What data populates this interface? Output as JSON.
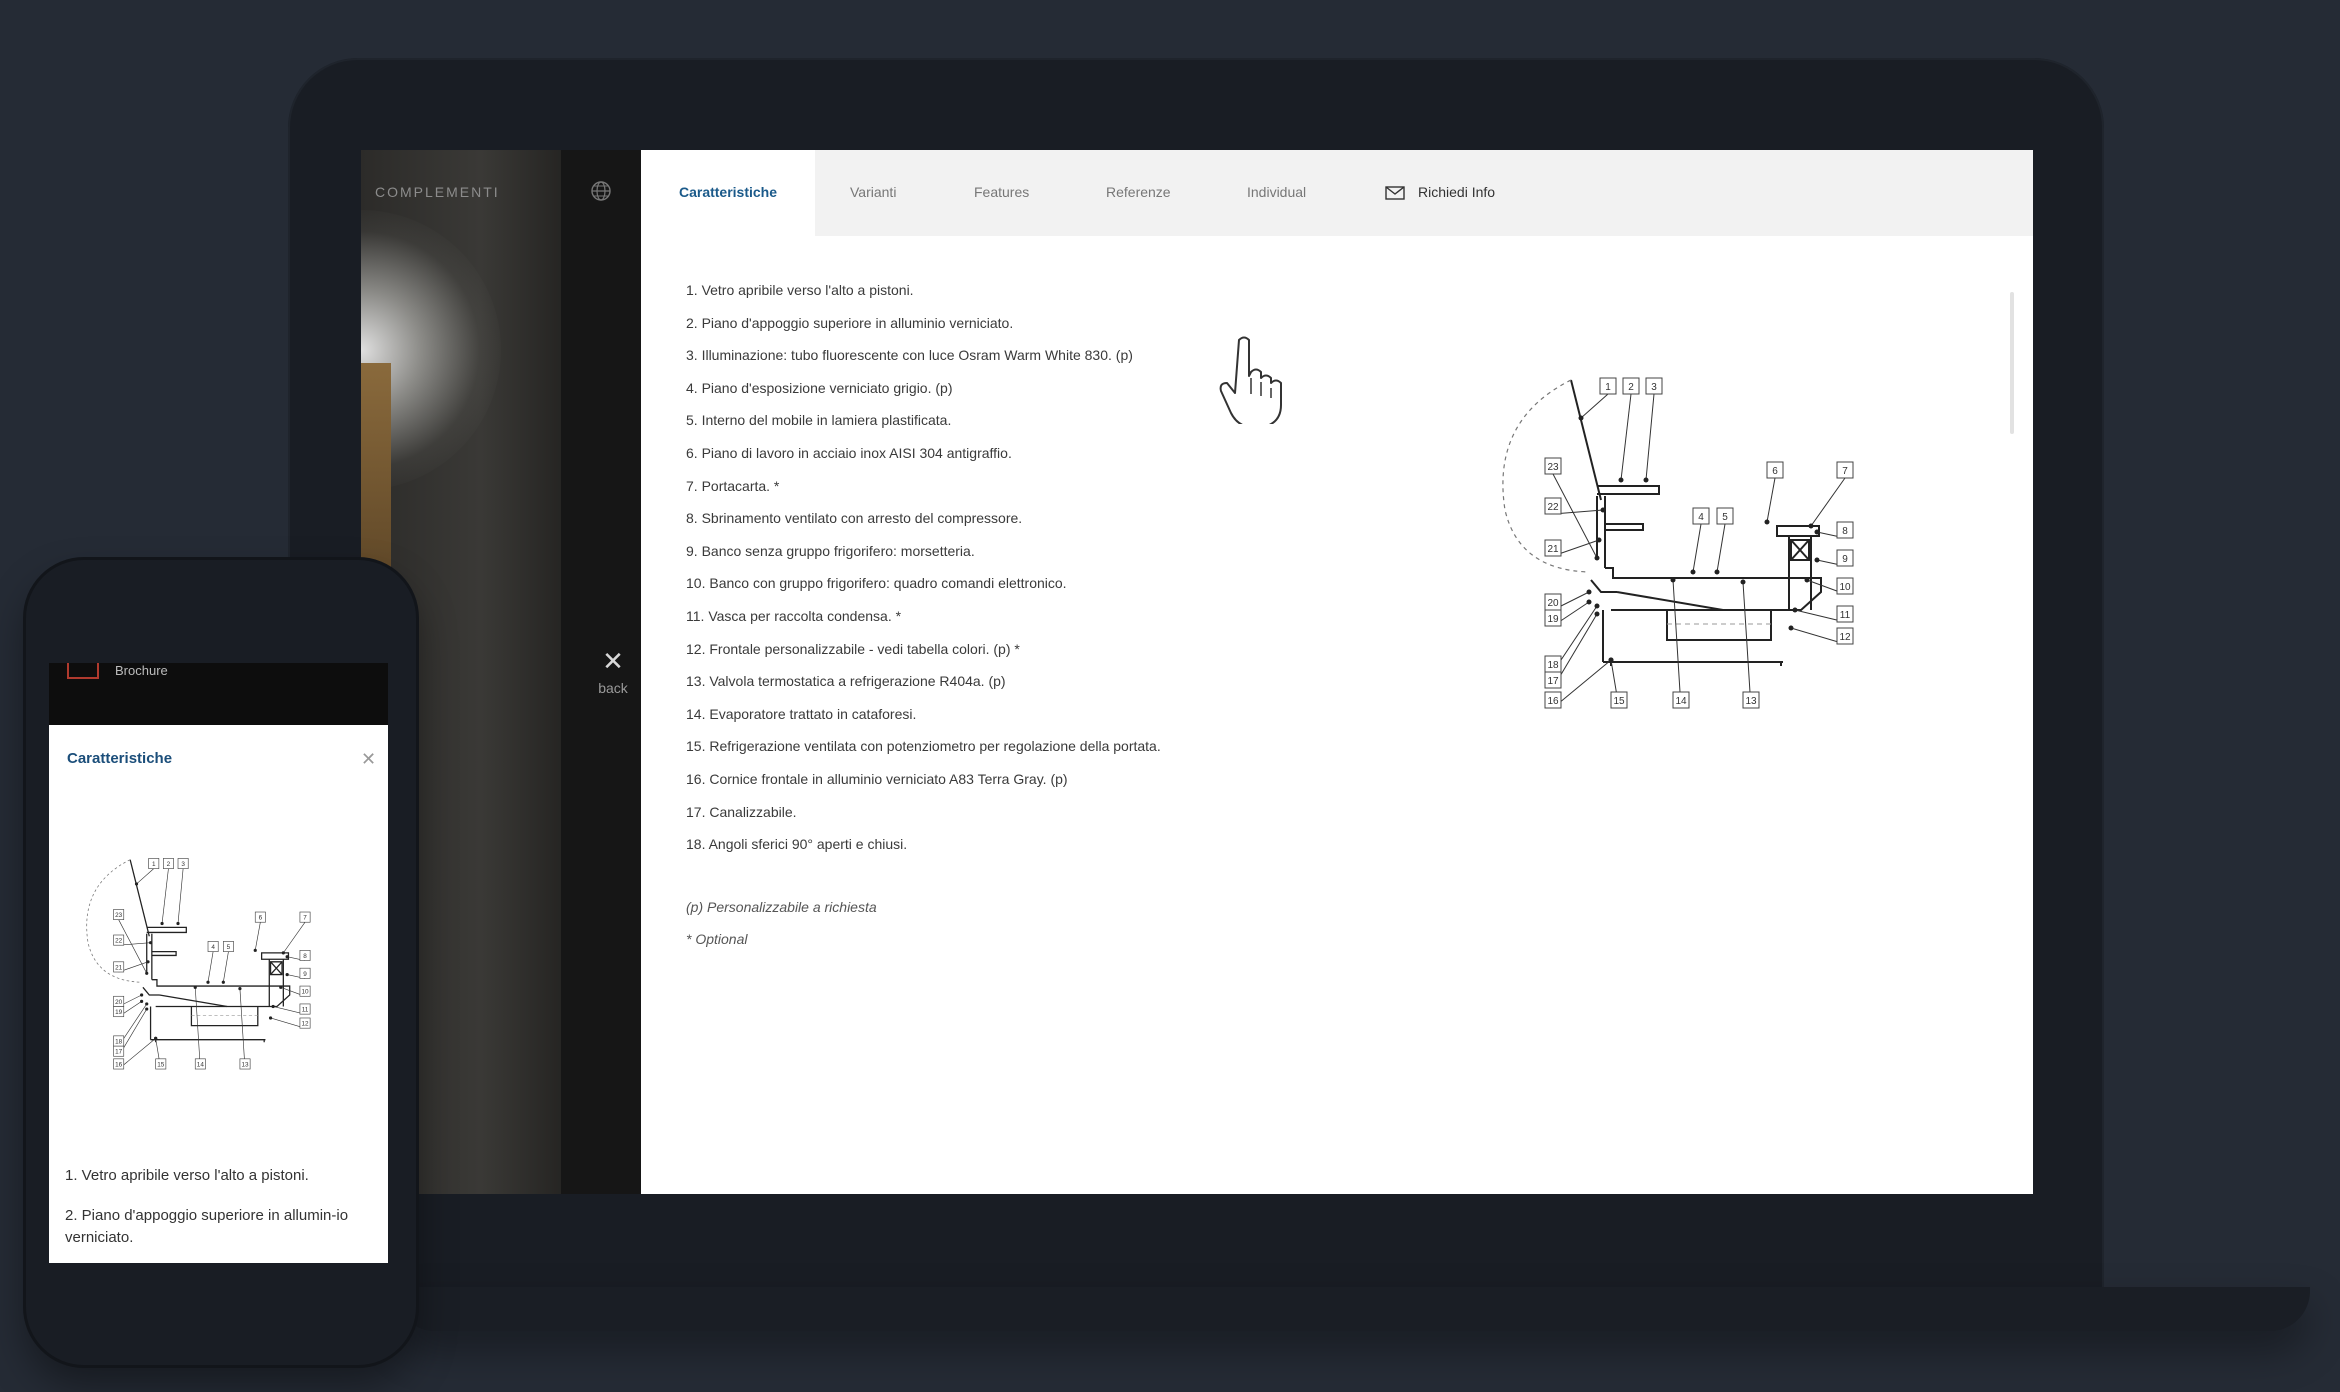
{
  "sidebar": {
    "brand": "COMPLEMENTI",
    "back_label": "back",
    "icons": [
      "globe-icon",
      "close-icon"
    ]
  },
  "tabs": [
    {
      "label": "Caratteristiche",
      "active": true
    },
    {
      "label": "Varianti",
      "active": false
    },
    {
      "label": "Features",
      "active": false
    },
    {
      "label": "Referenze",
      "active": false
    },
    {
      "label": "Individual",
      "active": false
    },
    {
      "label": "Richiedi Info",
      "active": false,
      "icon": "mail-icon"
    }
  ],
  "features": [
    "1. Vetro apribile verso l'alto a pistoni.",
    "2. Piano d'appoggio superiore in alluminio verniciato.",
    "3. Illuminazione: tubo fluorescente con luce Osram Warm White 830. (p)",
    "4. Piano d'esposizione verniciato grigio. (p)",
    "5. Interno del mobile in lamiera plastificata.",
    "6. Piano di lavoro in acciaio inox AISI 304 antigraffio.",
    "7. Portacarta. *",
    "8. Sbrinamento ventilato con arresto del compressore.",
    "9. Banco senza gruppo frigorifero: morsetteria.",
    "10. Banco con gruppo frigorifero: quadro comandi elettronico.",
    "11. Vasca per raccolta condensa. *",
    "12. Frontale personalizzabile - vedi tabella colori. (p) *",
    "13. Valvola termostatica a refrigerazione R404a. (p)",
    "14. Evaporatore trattato in cataforesi.",
    "15. Refrigerazione ventilata con potenziometro per regolazione della portata.",
    "16. Cornice frontale in alluminio verniciato A83 Terra Gray. (p)",
    "17. Canalizzabile.",
    "18. Angoli sferici 90° aperti e chiusi."
  ],
  "notes": [
    "(p) Personalizzabile a richiesta",
    "* Optional"
  ],
  "diagram_labels": [
    "1",
    "2",
    "3",
    "4",
    "5",
    "6",
    "7",
    "8",
    "9",
    "10",
    "11",
    "12",
    "13",
    "14",
    "15",
    "16",
    "17",
    "18",
    "19",
    "20",
    "21",
    "22",
    "23"
  ],
  "phone": {
    "brochure_label": "Brochure",
    "title": "Caratteristiche",
    "items": [
      "1. Vetro apribile verso l'alto a pistoni.",
      "2. Piano d'appoggio superiore in allumin-io verniciato."
    ]
  },
  "colors": {
    "accent": "#1b5a8a",
    "background": "#252b35",
    "device": "#191d24"
  }
}
